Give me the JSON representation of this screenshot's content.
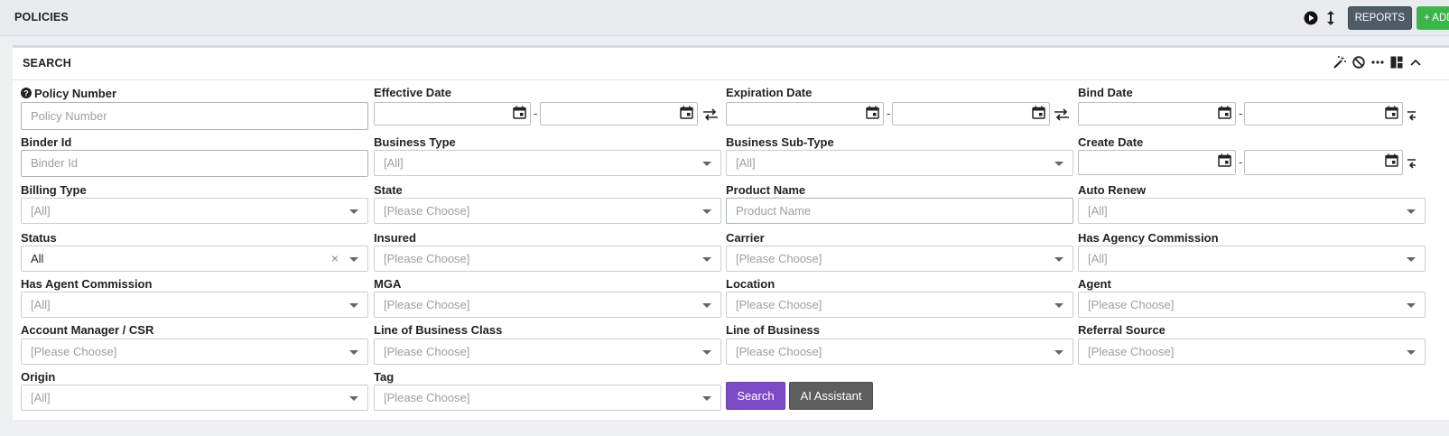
{
  "header": {
    "title": "POLICIES",
    "reports_label": "REPORTS",
    "add_label": "+ ADD",
    "icons": [
      "play-circle-icon",
      "resize-vertical-icon"
    ]
  },
  "panel": {
    "title": "SEARCH",
    "tool_icons": [
      "magic-wand-icon",
      "ban-icon",
      "more-horizontal-icon",
      "layout-icon",
      "collapse-icon"
    ]
  },
  "fields": {
    "policy_number": {
      "label": "Policy Number",
      "placeholder": "Policy Number"
    },
    "effective_date": {
      "label": "Effective Date"
    },
    "expiration_date": {
      "label": "Expiration Date"
    },
    "bind_date": {
      "label": "Bind Date"
    },
    "binder_id": {
      "label": "Binder Id",
      "placeholder": "Binder Id"
    },
    "business_type": {
      "label": "Business Type",
      "value": "[All]"
    },
    "business_sub_type": {
      "label": "Business Sub-Type",
      "value": "[All]"
    },
    "create_date": {
      "label": "Create Date"
    },
    "billing_type": {
      "label": "Billing Type",
      "value": "[All]"
    },
    "state": {
      "label": "State",
      "value": "[Please Choose]"
    },
    "product_name": {
      "label": "Product Name",
      "placeholder": "Product Name"
    },
    "auto_renew": {
      "label": "Auto Renew",
      "value": "[All]"
    },
    "status": {
      "label": "Status",
      "value": "All",
      "clear": "×"
    },
    "insured": {
      "label": "Insured",
      "value": "[Please Choose]"
    },
    "carrier": {
      "label": "Carrier",
      "value": "[Please Choose]"
    },
    "has_agency_commission": {
      "label": "Has Agency Commission",
      "value": "[All]"
    },
    "has_agent_commission": {
      "label": "Has Agent Commission",
      "value": "[All]"
    },
    "mga": {
      "label": "MGA",
      "value": "[Please Choose]"
    },
    "location": {
      "label": "Location",
      "value": "[Please Choose]"
    },
    "agent": {
      "label": "Agent",
      "value": "[Please Choose]"
    },
    "account_manager": {
      "label": "Account Manager / CSR",
      "value": "[Please Choose]"
    },
    "lob_class": {
      "label": "Line of Business Class",
      "value": "[Please Choose]"
    },
    "lob": {
      "label": "Line of Business",
      "value": "[Please Choose]"
    },
    "referral_source": {
      "label": "Referral Source",
      "value": "[Please Choose]"
    },
    "origin": {
      "label": "Origin",
      "value": "[All]"
    },
    "tag": {
      "label": "Tag",
      "value": "[Please Choose]"
    }
  },
  "date_separator": "-",
  "actions": {
    "search_label": "Search",
    "ai_label": "AI Assistant"
  },
  "colors": {
    "search_button": "#7e4bc6",
    "ai_button": "#5e5e5e",
    "reports_button": "#4f5b66",
    "add_button": "#3cb54a"
  }
}
